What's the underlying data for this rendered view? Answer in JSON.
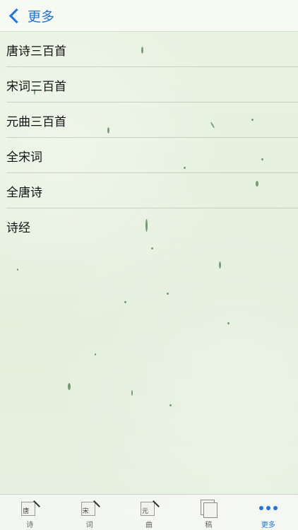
{
  "navbar": {
    "back_label": "更多"
  },
  "list": {
    "items": [
      "唐诗三百首",
      "宋词三百首",
      "元曲三百首",
      "全宋词",
      "全唐诗",
      "诗经"
    ]
  },
  "tabbar": {
    "tabs": [
      {
        "label": "诗",
        "icon_char": "唐",
        "icon": "pad-icon"
      },
      {
        "label": "词",
        "icon_char": "宋",
        "icon": "pad-icon"
      },
      {
        "label": "曲",
        "icon_char": "元",
        "icon": "pad-icon"
      },
      {
        "label": "稿",
        "icon": "drafts-icon"
      },
      {
        "label": "更多",
        "icon": "more-dots-icon",
        "active": true
      }
    ]
  },
  "colors": {
    "accent": "#1e73ea",
    "background": "#e6f1de"
  }
}
